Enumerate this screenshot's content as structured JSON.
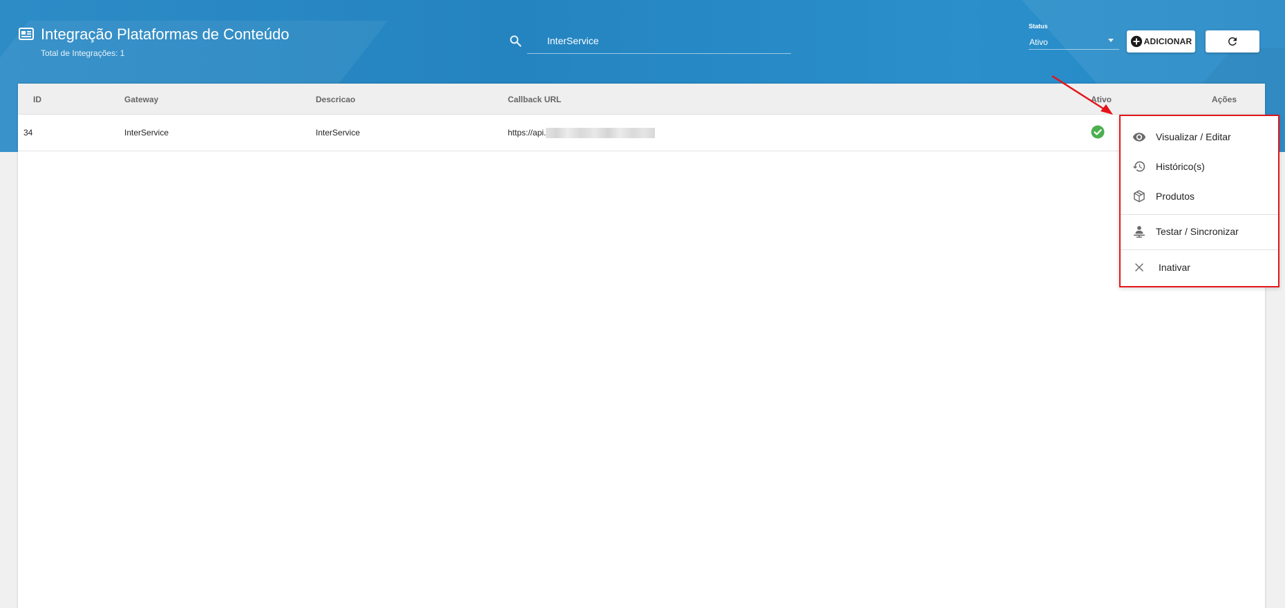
{
  "header": {
    "title": "Integração Plataformas de Conteúdo",
    "subtitle": "Total de Integrações: 1",
    "title_icon": "integration-icon"
  },
  "search": {
    "value": "InterService",
    "icon": "search-icon"
  },
  "status_filter": {
    "label": "Status",
    "value": "Ativo"
  },
  "toolbar": {
    "add_label": "ADICIONAR",
    "add_icon": "plus-circle-icon",
    "refresh_icon": "refresh-icon"
  },
  "table": {
    "columns": [
      "ID",
      "Gateway",
      "Descricao",
      "Callback URL",
      "Ativo",
      "Ações"
    ],
    "rows": [
      {
        "id": "34",
        "gateway": "InterService",
        "descricao": "InterService",
        "callback_url": "https://api.",
        "ativo": true
      }
    ]
  },
  "action_menu": {
    "items": [
      {
        "label": "Visualizar / Editar",
        "icon": "eye-icon"
      },
      {
        "label": "Histórico(s)",
        "icon": "history-icon"
      },
      {
        "label": "Produtos",
        "icon": "box-icon"
      },
      {
        "label": "Testar / Sincronizar",
        "icon": "person-sync-icon"
      },
      {
        "label": "Inativar",
        "icon": "close-icon"
      }
    ]
  },
  "colors": {
    "header_blue": "#2484c0",
    "highlight_red": "#e3151b",
    "active_green": "#4caf50"
  }
}
